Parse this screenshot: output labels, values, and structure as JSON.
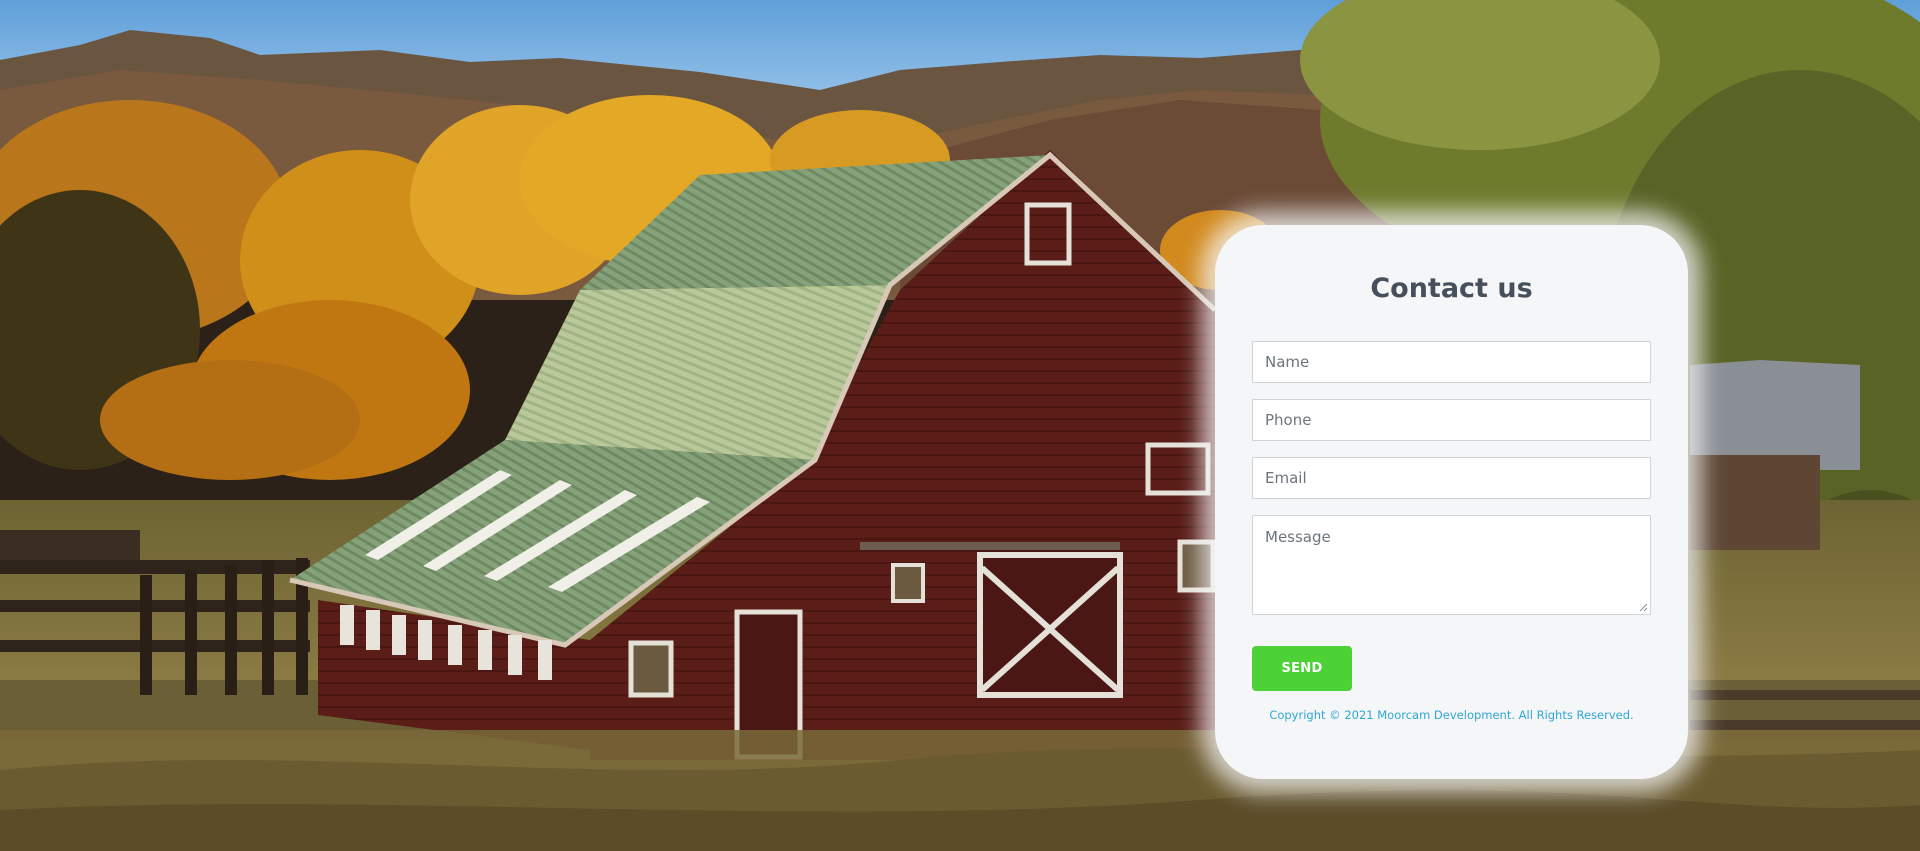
{
  "contact_form": {
    "title": "Contact us",
    "name_placeholder": "Name",
    "phone_placeholder": "Phone",
    "email_placeholder": "Email",
    "message_placeholder": "Message",
    "send_label": "SEND",
    "copyright": "Copyright © 2021 Moorcam Development. All Rights Reserved."
  },
  "colors": {
    "card_background": "#f5f6f8",
    "title": "#45505b",
    "send_button": "#4cd137",
    "copyright_text": "#2ea7d6"
  }
}
